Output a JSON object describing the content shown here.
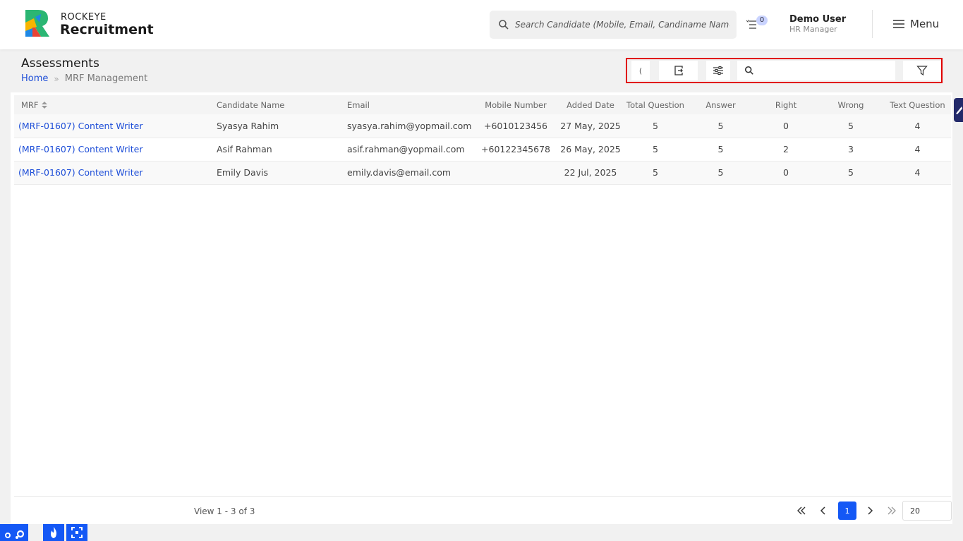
{
  "header": {
    "brand_top": "ROCKEYE",
    "brand_main": "Recruitment",
    "search_placeholder": "Search Candidate (Mobile, Email, Candiname Name)",
    "notification_count": "0",
    "user_name": "Demo User",
    "user_role": "HR Manager",
    "menu_label": "Menu"
  },
  "page": {
    "title": "Assessments",
    "breadcrumb": {
      "home": "Home",
      "separator": "»",
      "current": "MRF Management"
    }
  },
  "toolbar": {
    "btn1_label": "(",
    "search_placeholder": ""
  },
  "table": {
    "columns": [
      "MRF",
      "Candidate Name",
      "Email",
      "Mobile Number",
      "Added Date",
      "Total Question",
      "Answer",
      "Right",
      "Wrong",
      "Text Question"
    ],
    "rows": [
      [
        "(MRF-01607) Content Writer",
        "Syasya Rahim",
        "syasya.rahim@yopmail.com",
        "+6010123456",
        "27 May, 2025",
        "5",
        "5",
        "0",
        "5",
        "4"
      ],
      [
        "(MRF-01607) Content Writer",
        "Asif Rahman",
        "asif.rahman@yopmail.com",
        "+60122345678",
        "26 May, 2025",
        "5",
        "5",
        "2",
        "3",
        "4"
      ],
      [
        "(MRF-01607) Content Writer",
        "Emily Davis",
        "emily.davis@email.com",
        "",
        "22 Jul, 2025",
        "5",
        "5",
        "0",
        "5",
        "4"
      ]
    ]
  },
  "footer": {
    "view_count": "View 1 - 3 of 3",
    "current_page": "1",
    "page_size": "20"
  },
  "colors": {
    "accent": "#1458f5",
    "link": "#1f4fd8",
    "highlight_border": "#e00000"
  }
}
